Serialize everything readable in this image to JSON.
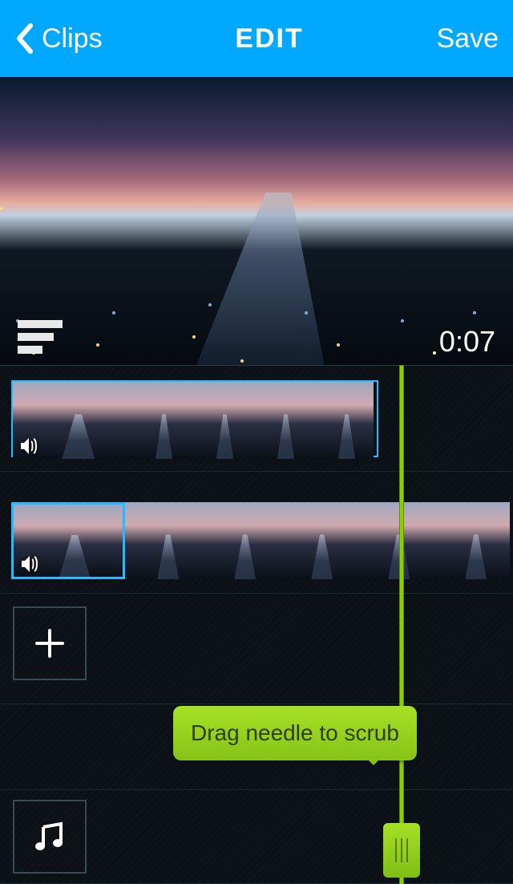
{
  "navbar": {
    "back_label": "Clips",
    "title": "EDIT",
    "save_label": "Save"
  },
  "preview": {
    "timecode": "0:07"
  },
  "timeline": {
    "tooltip_text": "Drag needle to scrub"
  }
}
